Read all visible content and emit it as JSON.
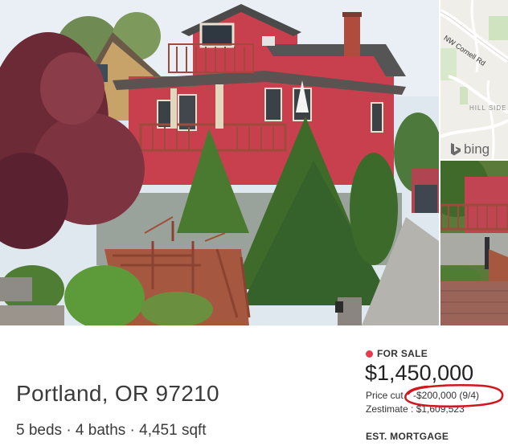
{
  "listing": {
    "address": "Portland, OR 97210",
    "facts": "5 beds · 4 baths · 4,451 sqft",
    "status": "FOR SALE",
    "price": "$1,450,000",
    "price_cut_label": "Price cut",
    "price_cut_value": "-$200,000 (9/4)",
    "zestimate_label": "Zestimate",
    "zestimate_value": "$1,609,523",
    "mortgage_label": "EST. MORTGAGE"
  },
  "map": {
    "road_label": "NW Cornell Rd",
    "area_label": "HILL SIDE",
    "provider": "bing"
  },
  "colors": {
    "status_dot": "#e8384f",
    "annotation": "#d0161e",
    "house": "#c8404e"
  }
}
